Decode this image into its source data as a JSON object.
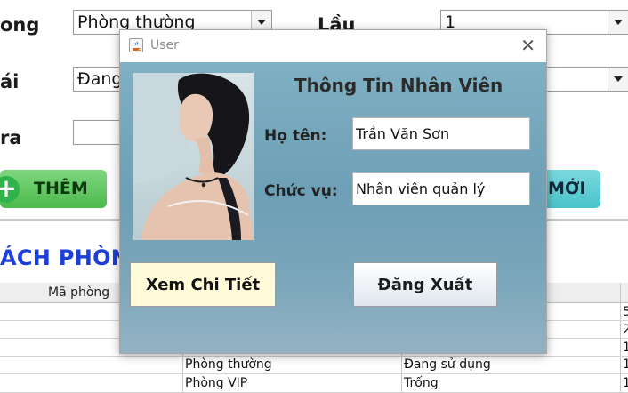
{
  "form": {
    "label_phong": "ong",
    "label_trangthai": "ái",
    "label_gia": "ra",
    "label_lau": "Lầu",
    "loai_phong_value": "Phòng thường",
    "lau_value": "1",
    "trang_thai_value": "Đang"
  },
  "buttons": {
    "them": "THÊM",
    "moi": "MỚI"
  },
  "section_title": "ÁCH PHÒNG",
  "table": {
    "headers": {
      "ma_phong": "Mã phòng"
    },
    "rows": [
      {
        "loai": "Phòng thường",
        "trang_thai": "Đang sử dụng",
        "gia": "1"
      },
      {
        "loai": "Phòng VIP",
        "trang_thai": "Trống",
        "gia": "1"
      }
    ],
    "right_edge_values": [
      "5",
      "2",
      "1",
      "1",
      "1"
    ]
  },
  "dialog": {
    "title": "User",
    "heading": "Thông Tin Nhân Viên",
    "name_label": "Họ tên:",
    "name_value": "Trần Văn Sơn",
    "role_label": "Chức vụ:",
    "role_value": "Nhân viên quản lý",
    "detail_button": "Xem Chi Tiết",
    "logout_button": "Đăng Xuất"
  },
  "icons": {
    "plus": "plus-icon",
    "java": "java-icon",
    "close": "close-icon",
    "dropdown": "chevron-down-icon"
  },
  "colors": {
    "section_title": "#1c3fd8",
    "them_button": "#4cb94c",
    "moi_button": "#49c3ca",
    "dialog_bg": "#7fb0c3"
  }
}
